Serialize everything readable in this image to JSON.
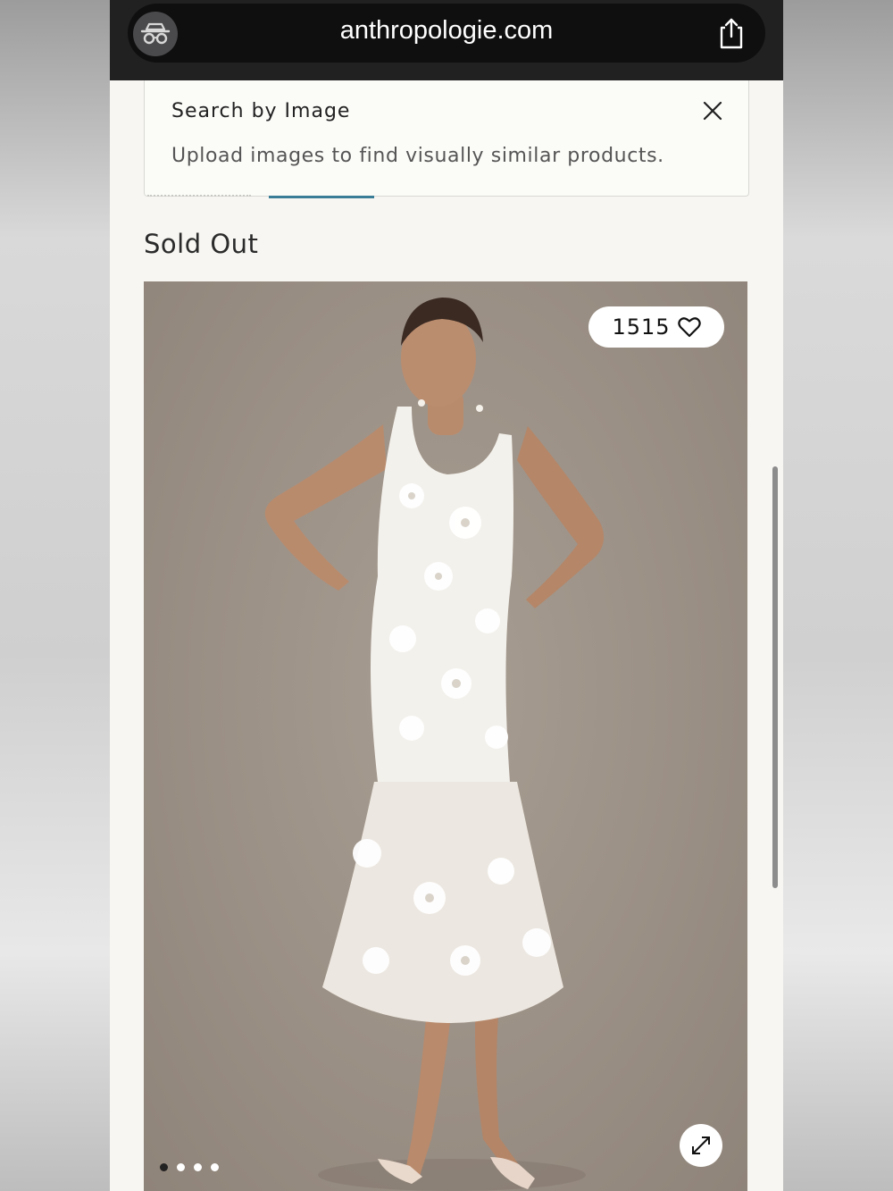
{
  "browser": {
    "url": "anthropologie.com",
    "privacy_icon": "incognito-glasses-icon",
    "share_icon": "share-icon"
  },
  "search_by_image": {
    "title": "Search by Image",
    "description": "Upload images to find visually similar products.",
    "close_icon": "close-icon"
  },
  "product": {
    "status": "Sold Out",
    "favorites_count": "1515",
    "image_count": 4,
    "active_image_index": 0
  },
  "colors": {
    "tab_accent": "#3a7d96",
    "image_backdrop": "#9b9085"
  }
}
